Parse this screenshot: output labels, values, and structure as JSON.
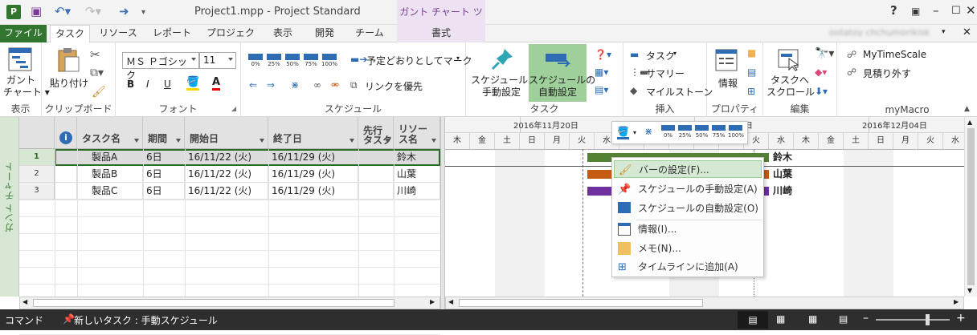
{
  "window": {
    "title": "Project1.mpp - Project Standard",
    "contextual_tab_group": "ガント チャート ツール",
    "help": "?",
    "account_label": "ootatoy chchumorikisk"
  },
  "tabs": [
    "ファイル",
    "タスク",
    "リソース",
    "レポート",
    "プロジェクト",
    "表示",
    "開発",
    "チーム",
    "書式"
  ],
  "ribbon": {
    "view": {
      "button": "ガント\nチャート",
      "btn_line1": "ガント",
      "btn_line2": "チャート ▾",
      "group": "表示"
    },
    "clipboard": {
      "paste": "貼り付け",
      "group": "クリップボード"
    },
    "font": {
      "font_name": "ＭＳ Ｐゴシック",
      "font_size": "11",
      "bold": "B",
      "italic": "I",
      "underline": "U",
      "group": "フォント"
    },
    "schedule": {
      "pct": [
        "0%",
        "25%",
        "50%",
        "75%",
        "100%"
      ],
      "mark_on_track": "予定どおりとしてマーク",
      "respect_links": "リンクを優先",
      "group": "スケジュール"
    },
    "tasks": {
      "manual": "スケジュールの\n手動設定",
      "manual1": "スケジュールの",
      "manual2": "手動設定",
      "auto1": "スケジュールの",
      "auto2": "自動設定",
      "group": "タスク"
    },
    "insert": {
      "task": "タスク",
      "summary": "サマリー",
      "milestone": "マイルストーン",
      "group": "挿入"
    },
    "properties": {
      "info": "情報",
      "group": "プロパティ"
    },
    "editing": {
      "scroll1": "タスクへ",
      "scroll2": "スクロール",
      "group": "編集"
    },
    "mymacro": {
      "timescale": "MyTimeScale",
      "estimate": "見積り外す",
      "group": "myMacro"
    }
  },
  "view_bar_label": "ガント チャート",
  "table": {
    "columns": [
      "タスク名",
      "期間",
      "開始日",
      "終了日",
      "先行\nタスク",
      "リソー\nス名"
    ],
    "col_pred1": "先行",
    "col_pred2": "タスク",
    "col_res1": "リソー",
    "col_res2": "ス名",
    "rows": [
      {
        "id": "1",
        "name": "製品A",
        "duration": "6日",
        "start": "16/11/22 (火)",
        "finish": "16/11/29 (火)",
        "pred": "",
        "resource": "鈴木"
      },
      {
        "id": "2",
        "name": "製品B",
        "duration": "6日",
        "start": "16/11/22 (火)",
        "finish": "16/11/29 (火)",
        "pred": "",
        "resource": "山葉"
      },
      {
        "id": "3",
        "name": "製品C",
        "duration": "6日",
        "start": "16/11/22 (火)",
        "finish": "16/11/29 (火)",
        "pred": "",
        "resource": "川崎"
      }
    ]
  },
  "timescale": {
    "weeks": [
      {
        "label": "2016年11月20日"
      },
      {
        "label": "2016年11月27日"
      },
      {
        "label": "2016年12月04日"
      }
    ],
    "days": [
      "木",
      "金",
      "土",
      "日",
      "月",
      "火",
      "水",
      "木",
      "金",
      "土",
      "日",
      "月",
      "火",
      "水",
      "木",
      "金",
      "土",
      "日",
      "月",
      "火",
      "水"
    ]
  },
  "bars": [
    {
      "resource": "鈴木",
      "color": "#548235"
    },
    {
      "resource": "山葉",
      "color": "#c55a11"
    },
    {
      "resource": "川崎",
      "color": "#7030a0"
    }
  ],
  "context_menu": {
    "items": [
      "バーの設定(F)...",
      "スケジュールの手動設定(A)",
      "スケジュールの自動設定(O)",
      "情報(I)...",
      "メモ(N)...",
      "タイムラインに追加(A)"
    ]
  },
  "mini_toolbar": {
    "pct": [
      "0%",
      "25%",
      "50%",
      "75%",
      "100%"
    ]
  },
  "status_bar": {
    "mode": "コマンド",
    "new_tasks": "新しいタスク : 手動スケジュール"
  },
  "colors": {
    "accent": "#31752f",
    "context_tab": "#7a3c95"
  }
}
